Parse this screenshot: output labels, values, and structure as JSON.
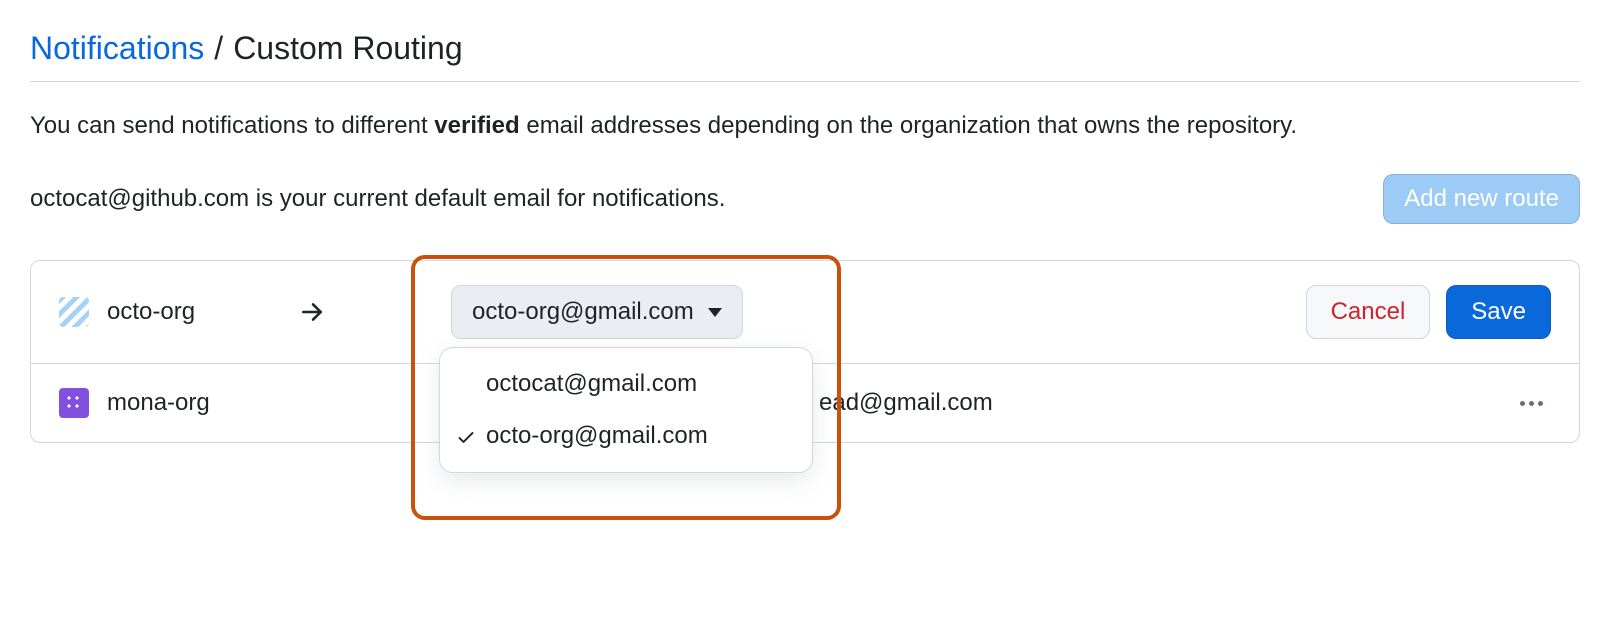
{
  "breadcrumb": {
    "link": "Notifications",
    "separator": "/",
    "current": "Custom Routing"
  },
  "description": {
    "prefix": "You can send notifications to different ",
    "strong": "verified",
    "suffix": " email addresses depending on the organization that owns the repository."
  },
  "defaultEmail": {
    "text": "octocat@github.com is your current default email for notifications."
  },
  "buttons": {
    "addRoute": "Add new route",
    "cancel": "Cancel",
    "save": "Save"
  },
  "routes": [
    {
      "org": "octo-org",
      "email": "octo-org@gmail.com",
      "editing": true
    },
    {
      "org": "mona-org",
      "email": "ead@gmail.com",
      "editing": false
    }
  ],
  "dropdown": {
    "options": [
      {
        "label": "octocat@gmail.com",
        "selected": false
      },
      {
        "label": "octo-org@gmail.com",
        "selected": true
      }
    ]
  }
}
